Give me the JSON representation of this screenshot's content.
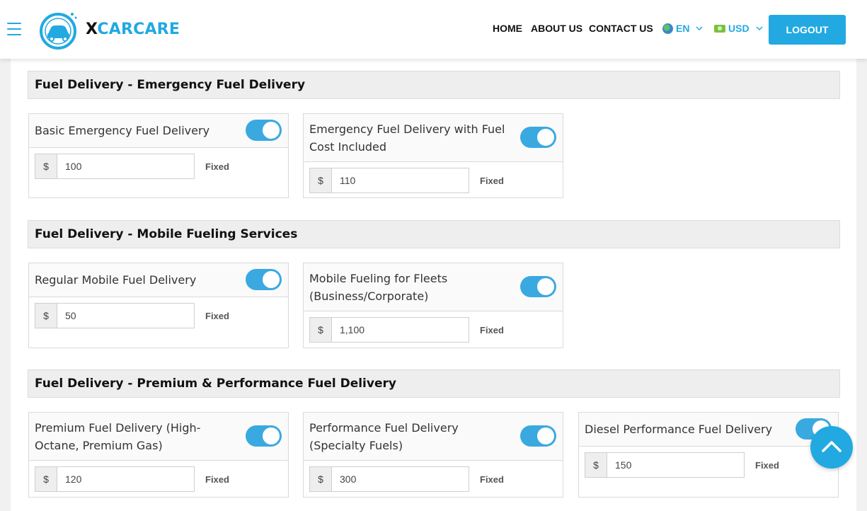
{
  "header": {
    "brand_x": "X",
    "brand_rest": "CARCARE",
    "nav": {
      "home": "HOME",
      "about": "ABOUT US",
      "contact": "CONTACT US",
      "language": "EN",
      "currency": "USD"
    },
    "logout_label": "LOGOUT"
  },
  "colors": {
    "accent": "#22a9e1",
    "toggle": "#3aa9e0"
  },
  "sections": [
    {
      "title": "Fuel Delivery - Emergency Fuel Delivery",
      "items": [
        {
          "name": "Basic Emergency Fuel Delivery",
          "currency": "$",
          "price": "100",
          "type": "Fixed",
          "enabled": true
        },
        {
          "name": "Emergency Fuel Delivery with Fuel Cost Included",
          "currency": "$",
          "price": "110",
          "type": "Fixed",
          "enabled": true
        }
      ]
    },
    {
      "title": "Fuel Delivery - Mobile Fueling Services",
      "items": [
        {
          "name": "Regular Mobile Fuel Delivery",
          "currency": "$",
          "price": "50",
          "type": "Fixed",
          "enabled": true
        },
        {
          "name": "Mobile Fueling for Fleets (Business/Corporate)",
          "currency": "$",
          "price": "1,100",
          "type": "Fixed",
          "enabled": true
        }
      ]
    },
    {
      "title": "Fuel Delivery - Premium & Performance Fuel Delivery",
      "items": [
        {
          "name": "Premium Fuel Delivery (High-Octane, Premium Gas)",
          "currency": "$",
          "price": "120",
          "type": "Fixed",
          "enabled": true
        },
        {
          "name": "Performance Fuel Delivery (Specialty Fuels)",
          "currency": "$",
          "price": "300",
          "type": "Fixed",
          "enabled": true
        },
        {
          "name": "Diesel Performance Fuel Delivery",
          "currency": "$",
          "price": "150",
          "type": "Fixed",
          "enabled": true
        }
      ]
    }
  ]
}
